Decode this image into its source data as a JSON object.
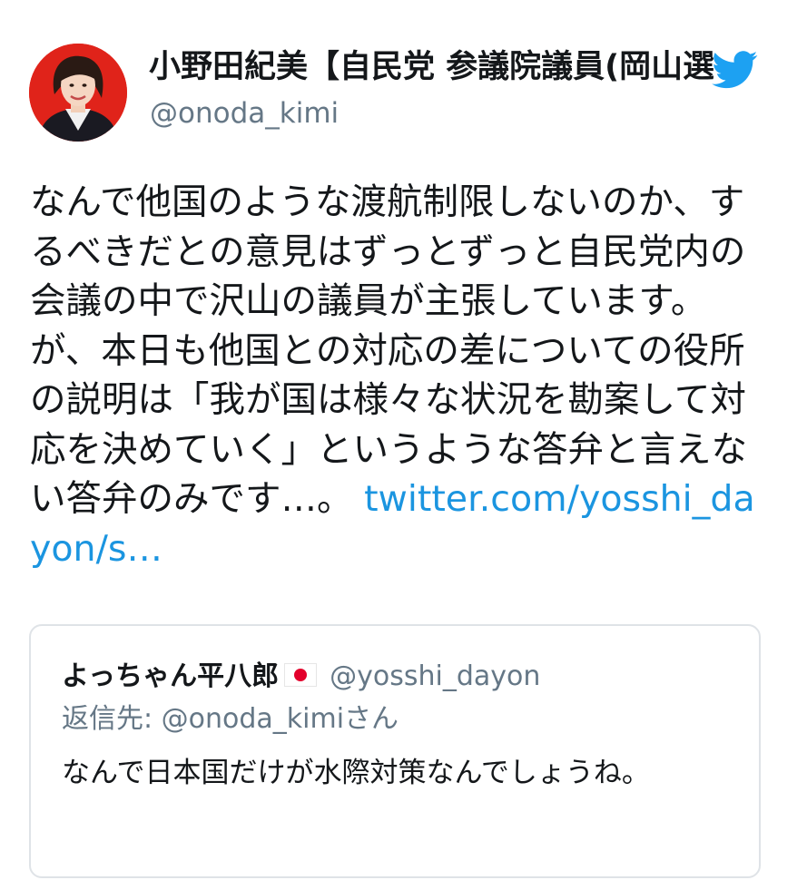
{
  "author": {
    "name": "小野田紀美【自民党 参議院議員(岡山選挙区)】",
    "handle": "@onoda_kimi"
  },
  "tweet": {
    "text": "なんで他国のような渡航制限しないのか、するべきだとの意見はずっとずっと自民党内の会議の中で沢山の議員が主張しています。が、本日も他国との対応の差についての役所の説明は「我が国は様々な状況を勘案して対応を決めていく」というような答弁と言えない答弁のみです…。 ",
    "link": "twitter.com/yosshi_dayon/s…"
  },
  "quoted": {
    "name": "よっちゃん平八郎",
    "handle": "@yosshi_dayon",
    "reply_to": "返信先: @onoda_kimiさん",
    "text": "なんで日本国だけが水際対策なんでしょうね。"
  },
  "colors": {
    "link": "#1b95e0",
    "secondary_text": "#657786",
    "twitter_blue": "#1da1f2",
    "avatar_bg": "#e0231a"
  },
  "icons": {
    "brand": "twitter-bird-icon",
    "flag": "japan-flag-icon"
  }
}
